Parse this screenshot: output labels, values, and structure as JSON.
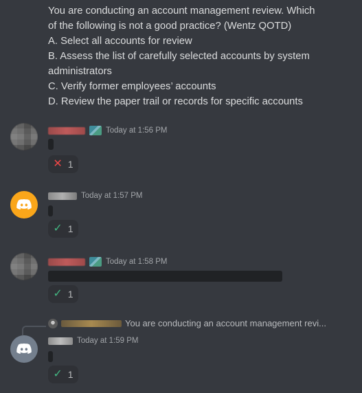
{
  "qotd": {
    "lines": [
      "You are conducting an account management review. Which",
      "of the following is not a good practice? (Wentz QOTD)",
      "A. Select all accounts for review",
      "B. Assess the list of carefully selected accounts by system",
      "administrators",
      "C. Verify former employees’ accounts",
      "D. Review the paper trail or records for specific accounts"
    ]
  },
  "messages": [
    {
      "timestamp": "Today at 1:56 PM",
      "reaction": {
        "emoji": "✕",
        "count": "1",
        "color": "#f04747"
      }
    },
    {
      "timestamp": "Today at 1:57 PM",
      "reaction": {
        "emoji": "✓",
        "count": "1",
        "color": "#43b581"
      }
    },
    {
      "timestamp": "Today at 1:58 PM",
      "reaction": {
        "emoji": "✓",
        "count": "1",
        "color": "#43b581"
      }
    },
    {
      "reply_preview": "You are conducting an account management revi...",
      "timestamp": "Today at 1:59 PM",
      "reaction": {
        "emoji": "✓",
        "count": "1",
        "color": "#43b581"
      }
    }
  ],
  "colors": {
    "background": "#36393f",
    "discord_orange": "#faa61a",
    "discord_gray": "#747f8d"
  }
}
